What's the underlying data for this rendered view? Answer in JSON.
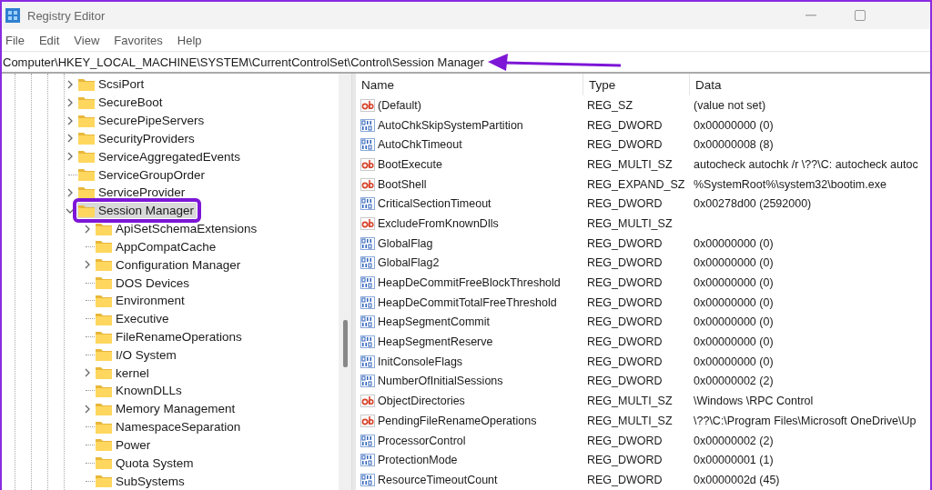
{
  "window": {
    "title": "Registry Editor"
  },
  "menu": [
    "File",
    "Edit",
    "View",
    "Favorites",
    "Help"
  ],
  "address_bar": {
    "value": "Computer\\HKEY_LOCAL_MACHINE\\SYSTEM\\CurrentControlSet\\Control\\Session Manager",
    "annotated": true
  },
  "tree": [
    {
      "label": "ScsiPort",
      "has_children": true,
      "expanded": false,
      "selected": false
    },
    {
      "label": "SecureBoot",
      "has_children": true,
      "expanded": false,
      "selected": false
    },
    {
      "label": "SecurePipeServers",
      "has_children": true,
      "expanded": false,
      "selected": false
    },
    {
      "label": "SecurityProviders",
      "has_children": true,
      "expanded": false,
      "selected": false
    },
    {
      "label": "ServiceAggregatedEvents",
      "has_children": true,
      "expanded": false,
      "selected": false
    },
    {
      "label": "ServiceGroupOrder",
      "has_children": false,
      "selected": false
    },
    {
      "label": "ServiceProvider",
      "has_children": true,
      "expanded": false,
      "selected": false
    },
    {
      "label": "Session Manager",
      "has_children": true,
      "expanded": true,
      "selected": true,
      "annotated": true,
      "children": [
        {
          "label": "ApiSetSchemaExtensions",
          "has_children": true,
          "expanded": false,
          "selected": false
        },
        {
          "label": "AppCompatCache",
          "has_children": false,
          "selected": false
        },
        {
          "label": "Configuration Manager",
          "has_children": true,
          "expanded": false,
          "selected": false
        },
        {
          "label": "DOS Devices",
          "has_children": false,
          "selected": false
        },
        {
          "label": "Environment",
          "has_children": false,
          "selected": false
        },
        {
          "label": "Executive",
          "has_children": false,
          "selected": false
        },
        {
          "label": "FileRenameOperations",
          "has_children": false,
          "selected": false
        },
        {
          "label": "I/O System",
          "has_children": false,
          "selected": false
        },
        {
          "label": "kernel",
          "has_children": true,
          "expanded": false,
          "selected": false
        },
        {
          "label": "KnownDLLs",
          "has_children": false,
          "selected": false
        },
        {
          "label": "Memory Management",
          "has_children": true,
          "expanded": false,
          "selected": false
        },
        {
          "label": "NamespaceSeparation",
          "has_children": false,
          "selected": false
        },
        {
          "label": "Power",
          "has_children": false,
          "selected": false
        },
        {
          "label": "Quota System",
          "has_children": false,
          "selected": false
        },
        {
          "label": "SubSystems",
          "has_children": false,
          "selected": false
        }
      ]
    }
  ],
  "table": {
    "columns": [
      "Name",
      "Type",
      "Data"
    ],
    "rows": [
      {
        "kind": "string",
        "name": "(Default)",
        "type": "REG_SZ",
        "data": "(value not set)"
      },
      {
        "kind": "binary",
        "name": "AutoChkSkipSystemPartition",
        "type": "REG_DWORD",
        "data": "0x00000000 (0)"
      },
      {
        "kind": "binary",
        "name": "AutoChkTimeout",
        "type": "REG_DWORD",
        "data": "0x00000008 (8)"
      },
      {
        "kind": "string",
        "name": "BootExecute",
        "type": "REG_MULTI_SZ",
        "data": "autocheck autochk /r \\??\\C: autocheck autoc"
      },
      {
        "kind": "string",
        "name": "BootShell",
        "type": "REG_EXPAND_SZ",
        "data": "%SystemRoot%\\system32\\bootim.exe"
      },
      {
        "kind": "binary",
        "name": "CriticalSectionTimeout",
        "type": "REG_DWORD",
        "data": "0x00278d00 (2592000)"
      },
      {
        "kind": "string",
        "name": "ExcludeFromKnownDlls",
        "type": "REG_MULTI_SZ"
      },
      {
        "kind": "binary",
        "name": "GlobalFlag",
        "type": "REG_DWORD",
        "data": "0x00000000 (0)"
      },
      {
        "kind": "binary",
        "name": "GlobalFlag2",
        "type": "REG_DWORD",
        "data": "0x00000000 (0)"
      },
      {
        "kind": "binary",
        "name": "HeapDeCommitFreeBlockThreshold",
        "type": "REG_DWORD",
        "data": "0x00000000 (0)"
      },
      {
        "kind": "binary",
        "name": "HeapDeCommitTotalFreeThreshold",
        "type": "REG_DWORD",
        "data": "0x00000000 (0)"
      },
      {
        "kind": "binary",
        "name": "HeapSegmentCommit",
        "type": "REG_DWORD",
        "data": "0x00000000 (0)"
      },
      {
        "kind": "binary",
        "name": "HeapSegmentReserve",
        "type": "REG_DWORD",
        "data": "0x00000000 (0)"
      },
      {
        "kind": "binary",
        "name": "InitConsoleFlags",
        "type": "REG_DWORD",
        "data": "0x00000000 (0)"
      },
      {
        "kind": "binary",
        "name": "NumberOfInitialSessions",
        "type": "REG_DWORD",
        "data": "0x00000002 (2)"
      },
      {
        "kind": "string",
        "name": "ObjectDirectories",
        "type": "REG_MULTI_SZ",
        "data": "\\Windows \\RPC Control"
      },
      {
        "kind": "string",
        "name": "PendingFileRenameOperations",
        "type": "REG_MULTI_SZ",
        "data": "\\??\\C:\\Program Files\\Microsoft OneDrive\\Up"
      },
      {
        "kind": "binary",
        "name": "ProcessorControl",
        "type": "REG_DWORD",
        "data": "0x00000002 (2)"
      },
      {
        "kind": "binary",
        "name": "ProtectionMode",
        "type": "REG_DWORD",
        "data": "0x00000001 (1)"
      },
      {
        "kind": "binary",
        "name": "ResourceTimeoutCount",
        "type": "REG_DWORD",
        "data": "0x0000002d (45)"
      }
    ]
  }
}
